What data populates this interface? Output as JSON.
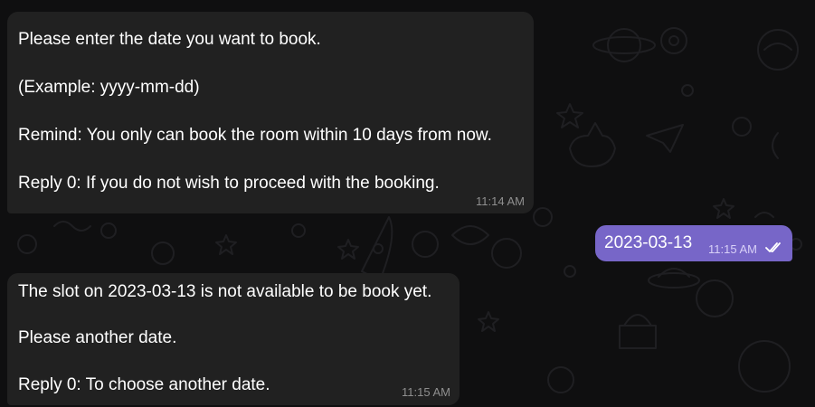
{
  "messages": {
    "incoming_1": {
      "lines": [
        "Please enter the date you want to book.",
        "(Example: yyyy-mm-dd)",
        "Remind: You only can book the room within 10 days from now.",
        "Reply 0: If you do not wish to proceed with the booking."
      ],
      "time": "11:14 AM"
    },
    "outgoing_1": {
      "text": "2023-03-13",
      "time": "11:15 AM",
      "status_icon": "double-check-icon"
    },
    "incoming_2": {
      "lines": [
        "The slot on 2023-03-13 is not available to be book yet.",
        "Please another date.",
        "Reply 0: To choose another date."
      ],
      "time": "11:15 AM"
    }
  },
  "colors": {
    "background": "#0f0f10",
    "incoming_bubble": "#212121",
    "outgoing_bubble": "#7766c8",
    "timestamp_incoming": "#8f8f8f",
    "timestamp_outgoing": "#d8d0f7"
  }
}
